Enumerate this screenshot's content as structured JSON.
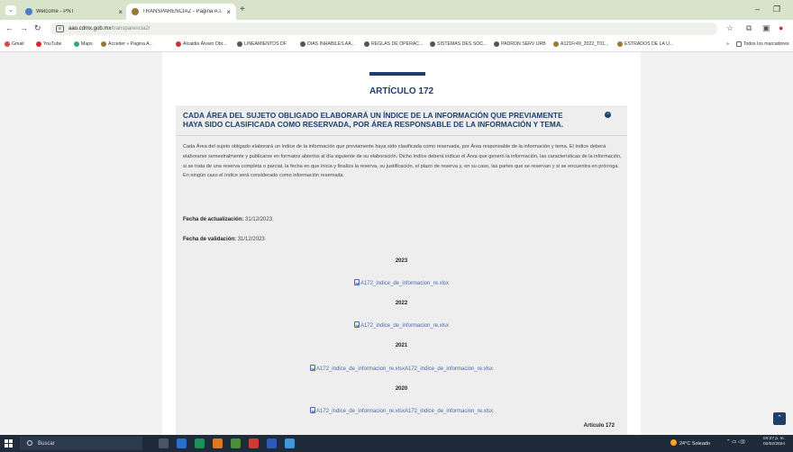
{
  "browser": {
    "tabs": [
      {
        "label": "Welcome - PNT",
        "icon_color": "#4a7bd0"
      },
      {
        "label": "TRANSPARENCIAZ - Pagina A.I.",
        "icon_color": "#9a7a2e"
      }
    ],
    "new_tab": "+",
    "url_host": "aao.cdmx.gob.mx",
    "url_path": "/transparencia2/",
    "bookmarks": [
      {
        "label": "Gmail",
        "color": "#d44"
      },
      {
        "label": "YouTube",
        "color": "#e22"
      },
      {
        "label": "Maps",
        "color": "#3a7"
      },
      {
        "label": "Acceder » Pagina A...",
        "color": "#9a7a2e"
      },
      {
        "label": "Alcaldia Álvaro Obr...",
        "color": "#c33"
      },
      {
        "label": "LINEAMIENTOS DF",
        "color": "#555"
      },
      {
        "label": "DIAS INHABILES AA...",
        "color": "#555"
      },
      {
        "label": "REGLAS DE OPERAC...",
        "color": "#555"
      },
      {
        "label": "SISTEMAS DES SOC...",
        "color": "#555"
      },
      {
        "label": "PADRON SERV URB",
        "color": "#555"
      },
      {
        "label": "A121Fr49_2022_T01...",
        "color": "#9a7a2e"
      },
      {
        "label": "ESTRADOS DE LA U...",
        "color": "#9a7a2e"
      }
    ],
    "all_bookmarks": "Todos los marcadores"
  },
  "page": {
    "article_title": "ARTÍCULO 172",
    "panel_heading": "CADA ÁREA DEL SUJETO OBLIGADO ELABORARÁ UN ÍNDICE DE LA INFORMACIÓN QUE PREVIAMENTE HAYA SIDO CLASIFICADA COMO RESERVADA, POR ÁREA RESPONSABLE DE LA INFORMACIÓN Y TEMA.",
    "body": "Cada Área del sujeto obligado elaborará un índice de la información que previamente haya sido clasificada como reservada, por Área responsable de la información y tema. El índice deberá elaborarse semestralmente y publicarse en formatos abiertos al día siguiente de su elaboración. Dicho índice deberá indicar el Área que generó la información, las características de la información, si se trata de una reserva completa o parcial, la fecha en que inicia y finaliza la reserva, su justificación, el plazo de reserva y, en su caso, las partes que se reservan y si se encuentra en prórroga. En ningún caso el índice será considerado como información reservada.",
    "update_label": "Fecha de actualización:",
    "update_value": "31/12/2023",
    "validation_label": "Fecha de validación:",
    "validation_value": "31/12/2023",
    "years": [
      {
        "year": "2023",
        "file": "A172_indice_de_informacion_re.xlsx"
      },
      {
        "year": "2022",
        "file": "A172_indice_de_informacion_re.xlsx"
      },
      {
        "year": "2021",
        "file": "A172_indice_de_informacion_re.xlsxA172_indice_de_informacion_re.xlsx"
      },
      {
        "year": "2020",
        "file": "A172_indice_de_informacion_re.xlsxA172_indice_de_informacion_re.xlsx"
      }
    ],
    "footer_label": "Artículo 172"
  },
  "taskbar": {
    "search_placeholder": "Buscar",
    "weather": "24°C Soleado",
    "time": "04:27 p. m.",
    "date": "02/02/2024"
  },
  "colors": {
    "accent": "#1e3e6e",
    "link": "#4a69a8",
    "tab_bar": "#d7e4c9"
  }
}
